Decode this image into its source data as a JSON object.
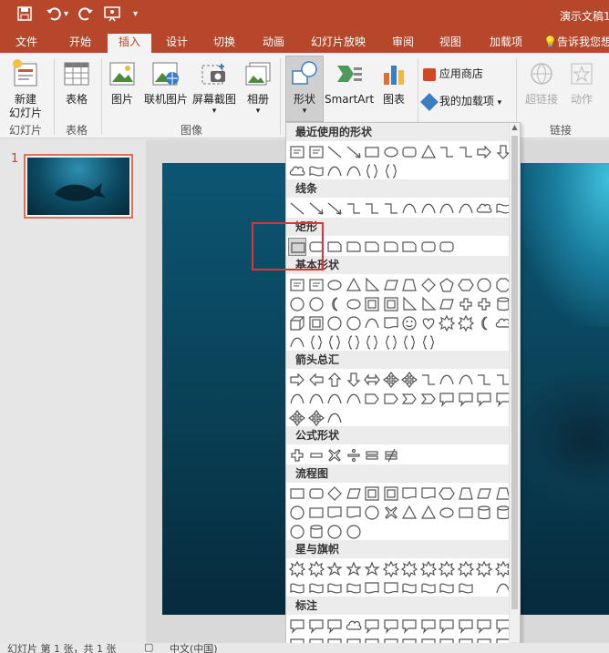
{
  "title_bar": {
    "doc_title": "演示文稿1",
    "qa_icons": [
      "save-icon",
      "undo-icon",
      "redo-icon",
      "present-from-start-icon",
      "customize-qat-icon"
    ]
  },
  "tabs": [
    "文件",
    "开始",
    "插入",
    "设计",
    "切换",
    "动画",
    "幻灯片放映",
    "审阅",
    "视图",
    "加载项",
    "告诉我您想"
  ],
  "active_tab": "插入",
  "ribbon": {
    "groups": {
      "slides": "幻灯片",
      "tables": "表格",
      "images": "图像",
      "links": "链接"
    },
    "buttons": {
      "new_slide_1": "新建",
      "new_slide_2": "幻灯片",
      "table": "表格",
      "picture": "图片",
      "online_picture": "联机图片",
      "screenshot": "屏幕截图",
      "album": "相册",
      "shapes": "形状",
      "smartart": "SmartArt",
      "chart": "图表",
      "store": "应用商店",
      "my_addins": "我的加载项",
      "hyperlink": "超链接",
      "action": "动作"
    }
  },
  "thumbnails": {
    "slide_number": "1"
  },
  "gallery": {
    "headers": [
      "最近使用的形状",
      "线条",
      "矩形",
      "基本形状",
      "箭头总汇",
      "公式形状",
      "流程图",
      "星与旗帜",
      "标注"
    ]
  },
  "status": {
    "slide_info": "幻灯片 第 1 张，共 1 张",
    "lang": "中文(中国)"
  },
  "colors": {
    "accent": "#b7472a",
    "highlight": "#e0322e"
  }
}
